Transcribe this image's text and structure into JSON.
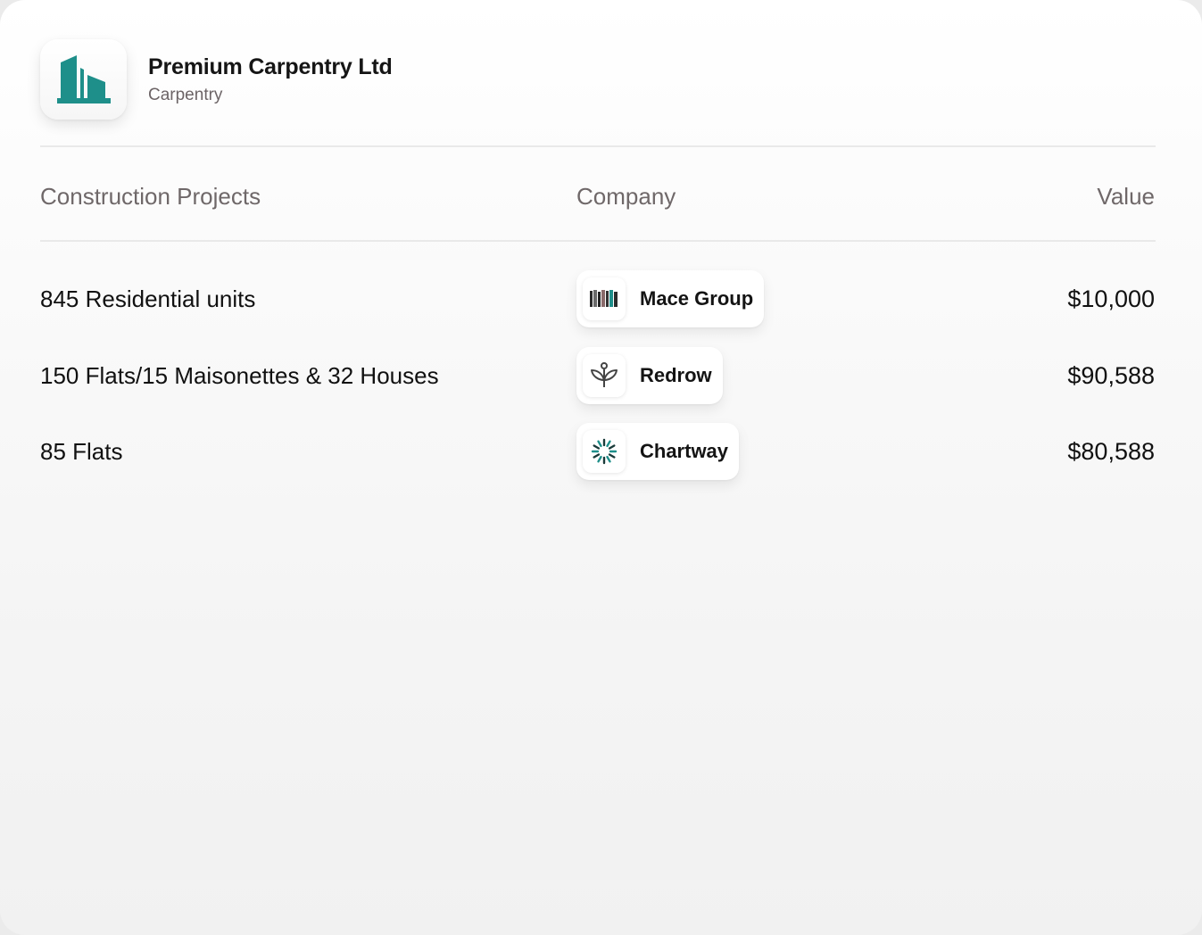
{
  "header": {
    "company_name": "Premium Carpentry Ltd",
    "category": "Carpentry",
    "logo_icon": "building-icon",
    "logo_color": "#1e8f8a"
  },
  "table": {
    "columns": {
      "project": "Construction Projects",
      "company": "Company",
      "value": "Value"
    },
    "rows": [
      {
        "project": "845 Residential units",
        "company": "Mace Group",
        "company_icon": "book-stack-icon",
        "value": "$10,000"
      },
      {
        "project": "150 Flats/15 Maisonettes & 32 Houses",
        "company": "Redrow",
        "company_icon": "sprout-icon",
        "value": "$90,588"
      },
      {
        "project": "85 Flats",
        "company": "Chartway",
        "company_icon": "radial-burst-icon",
        "value": "$80,588"
      }
    ]
  },
  "colors": {
    "teal": "#1e8f8a",
    "text_primary": "#111111",
    "text_muted": "#6f6869"
  }
}
